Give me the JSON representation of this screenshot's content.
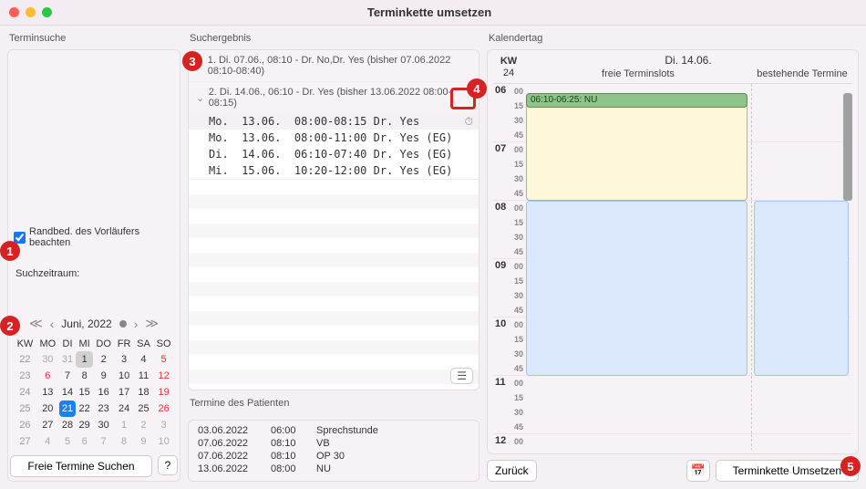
{
  "window_title": "Terminkette umsetzen",
  "col1": {
    "header": "Terminsuche",
    "checkbox_label": "Randbed. des Vorläufers beachten",
    "checkbox_checked": true,
    "suchzeitraum_label": "Suchzeitraum:",
    "month_label": "Juni, 2022",
    "weekdays": [
      "KW",
      "MO",
      "DI",
      "MI",
      "DO",
      "FR",
      "SA",
      "SO"
    ],
    "weeks": [
      {
        "kw": "22",
        "days": [
          {
            "n": "30",
            "dim": true
          },
          {
            "n": "31",
            "dim": true
          },
          {
            "n": "1",
            "today": true
          },
          {
            "n": "2"
          },
          {
            "n": "3"
          },
          {
            "n": "4"
          },
          {
            "n": "5",
            "sun": true
          }
        ]
      },
      {
        "kw": "23",
        "days": [
          {
            "n": "6",
            "sun": true
          },
          {
            "n": "7"
          },
          {
            "n": "8"
          },
          {
            "n": "9"
          },
          {
            "n": "10"
          },
          {
            "n": "11"
          },
          {
            "n": "12",
            "sun": true
          }
        ]
      },
      {
        "kw": "24",
        "days": [
          {
            "n": "13"
          },
          {
            "n": "14"
          },
          {
            "n": "15"
          },
          {
            "n": "16"
          },
          {
            "n": "17"
          },
          {
            "n": "18"
          },
          {
            "n": "19",
            "sun": true
          }
        ]
      },
      {
        "kw": "25",
        "days": [
          {
            "n": "20"
          },
          {
            "n": "21",
            "sel": true
          },
          {
            "n": "22"
          },
          {
            "n": "23"
          },
          {
            "n": "24"
          },
          {
            "n": "25"
          },
          {
            "n": "26",
            "sun": true
          }
        ]
      },
      {
        "kw": "26",
        "days": [
          {
            "n": "27"
          },
          {
            "n": "28"
          },
          {
            "n": "29"
          },
          {
            "n": "30"
          },
          {
            "n": "1",
            "dim": true
          },
          {
            "n": "2",
            "dim": true
          },
          {
            "n": "3",
            "dim": true
          }
        ]
      },
      {
        "kw": "27",
        "days": [
          {
            "n": "4",
            "dim": true
          },
          {
            "n": "5",
            "dim": true
          },
          {
            "n": "6",
            "dim": true
          },
          {
            "n": "7",
            "dim": true
          },
          {
            "n": "8",
            "dim": true
          },
          {
            "n": "9",
            "dim": true
          },
          {
            "n": "10",
            "dim": true
          }
        ]
      }
    ],
    "search_button": "Freie Termine Suchen",
    "help_button": "?"
  },
  "col2": {
    "header": "Suchergebnis",
    "group1": "1. Di. 07.06., 08:10 - Dr. No,Dr. Yes (bisher 07.06.2022 08:10-08:40)",
    "group2": "2. Di. 14.06., 06:10 - Dr. Yes (bisher 13.06.2022 08:00-08:15)",
    "slots": [
      "Mo.  13.06.  08:00-08:15 Dr. Yes",
      "Mo.  13.06.  08:00-11:00 Dr. Yes (EG)",
      "Di.  14.06.  06:10-07:40 Dr. Yes (EG)",
      "Mi.  15.06.  10:20-12:00 Dr. Yes (EG)"
    ],
    "patient_header": "Termine des Patienten",
    "patient_rows": [
      {
        "d": "03.06.2022",
        "t": "06:00",
        "x": "Sprechstunde"
      },
      {
        "d": "07.06.2022",
        "t": "08:10",
        "x": "VB"
      },
      {
        "d": "07.06.2022",
        "t": "08:10",
        "x": "OP 30"
      },
      {
        "d": "13.06.2022",
        "t": "08:00",
        "x": "NU"
      }
    ]
  },
  "col3": {
    "header": "Kalendertag",
    "kw_label": "KW",
    "kw_num": "24",
    "date_label": "Di. 14.06.",
    "free_label": "freie Terminslots",
    "exist_label": "bestehende Termine",
    "hours": [
      "06",
      "07",
      "08",
      "09",
      "10",
      "11",
      "12"
    ],
    "minutes": [
      "00",
      "15",
      "30",
      "45"
    ],
    "green_label": "06:10-06:25: NU",
    "back_button": "Zurück",
    "apply_button": "Terminkette Umsetzen"
  }
}
